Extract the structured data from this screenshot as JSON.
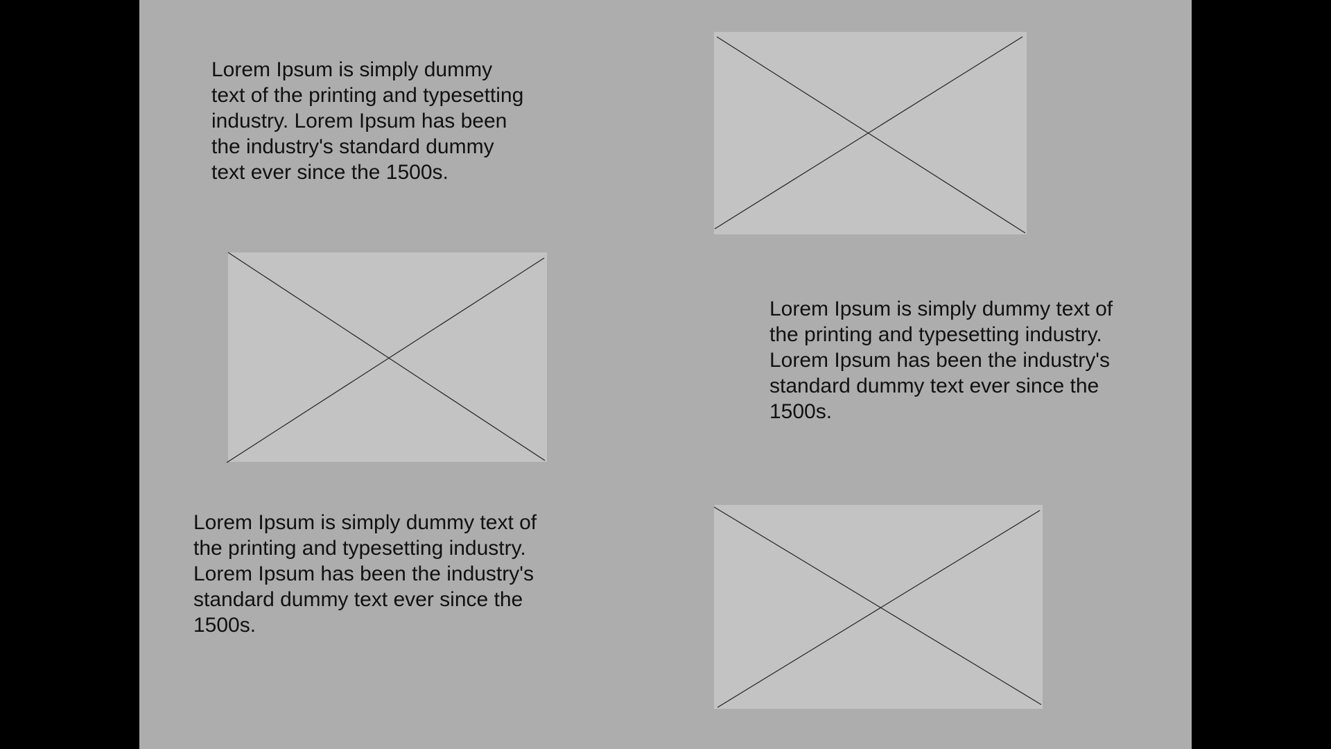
{
  "colors": {
    "outer_background": "#000000",
    "canvas_background": "#adadad",
    "placeholder_fill": "#c3c3c3",
    "text": "#111111",
    "placeholder_stroke": "#222222"
  },
  "blocks": {
    "text_1": "Lorem Ipsum is simply dummy\ntext of the printing and typesetting\nindustry. Lorem Ipsum has been\nthe industry's standard dummy\ntext ever since the 1500s.",
    "text_2": "Lorem Ipsum is simply dummy text of\nthe printing and typesetting industry.\nLorem Ipsum has been the industry's\nstandard dummy text ever since the\n1500s.",
    "text_3": "Lorem Ipsum is simply dummy text of\nthe printing and typesetting industry.\nLorem Ipsum has been the industry's\nstandard dummy text ever since the\n1500s."
  },
  "images": [
    {
      "icon": "image-placeholder-icon"
    },
    {
      "icon": "image-placeholder-icon"
    },
    {
      "icon": "image-placeholder-icon"
    }
  ]
}
